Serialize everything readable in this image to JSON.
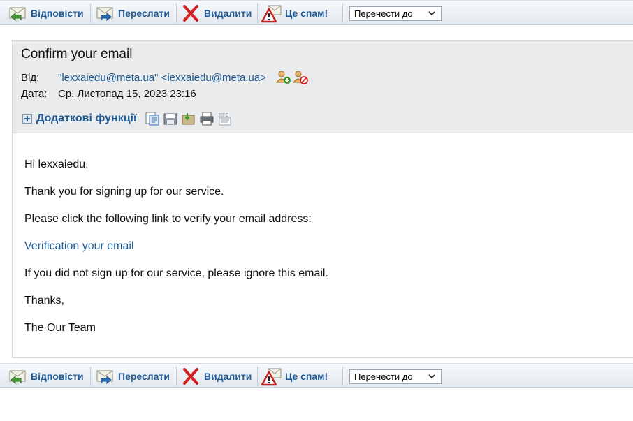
{
  "toolbar": {
    "reply_label": "Відповісти",
    "forward_label": "Переслати",
    "delete_label": "Видалити",
    "spam_label": "Це спам!",
    "move_to_label": "Перенести до"
  },
  "message": {
    "subject": "Confirm your email",
    "from_label": "Від:",
    "from_value": "\"lexxaiedu@meta.ua\" <lexxaiedu@meta.ua>",
    "date_label": "Дата:",
    "date_value": "Ср, Листопад 15, 2023 23:16",
    "extras_label": "Додаткові функції",
    "body": {
      "greeting": "Hi lexxaiedu,",
      "line1": "Thank you for signing up for our service.",
      "line2": "Please click the following link to verify your email address:",
      "link": "Verification your email",
      "line3": "If you did not sign up for our service, please ignore this email.",
      "thanks": "Thanks,",
      "signature": "The Our Team"
    }
  },
  "colors": {
    "accent": "#1f5a94",
    "header_bg": "#e9ebed",
    "delete_red": "#d42020"
  },
  "icons": {
    "reply": "reply-icon",
    "forward": "forward-icon",
    "delete": "delete-x-icon",
    "spam": "spam-warning-icon",
    "add_contact": "add-contact-icon",
    "block_contact": "block-contact-icon",
    "actions": [
      "view-source-icon",
      "save-icon",
      "download-icon",
      "print-icon",
      "rfc-icon"
    ]
  }
}
